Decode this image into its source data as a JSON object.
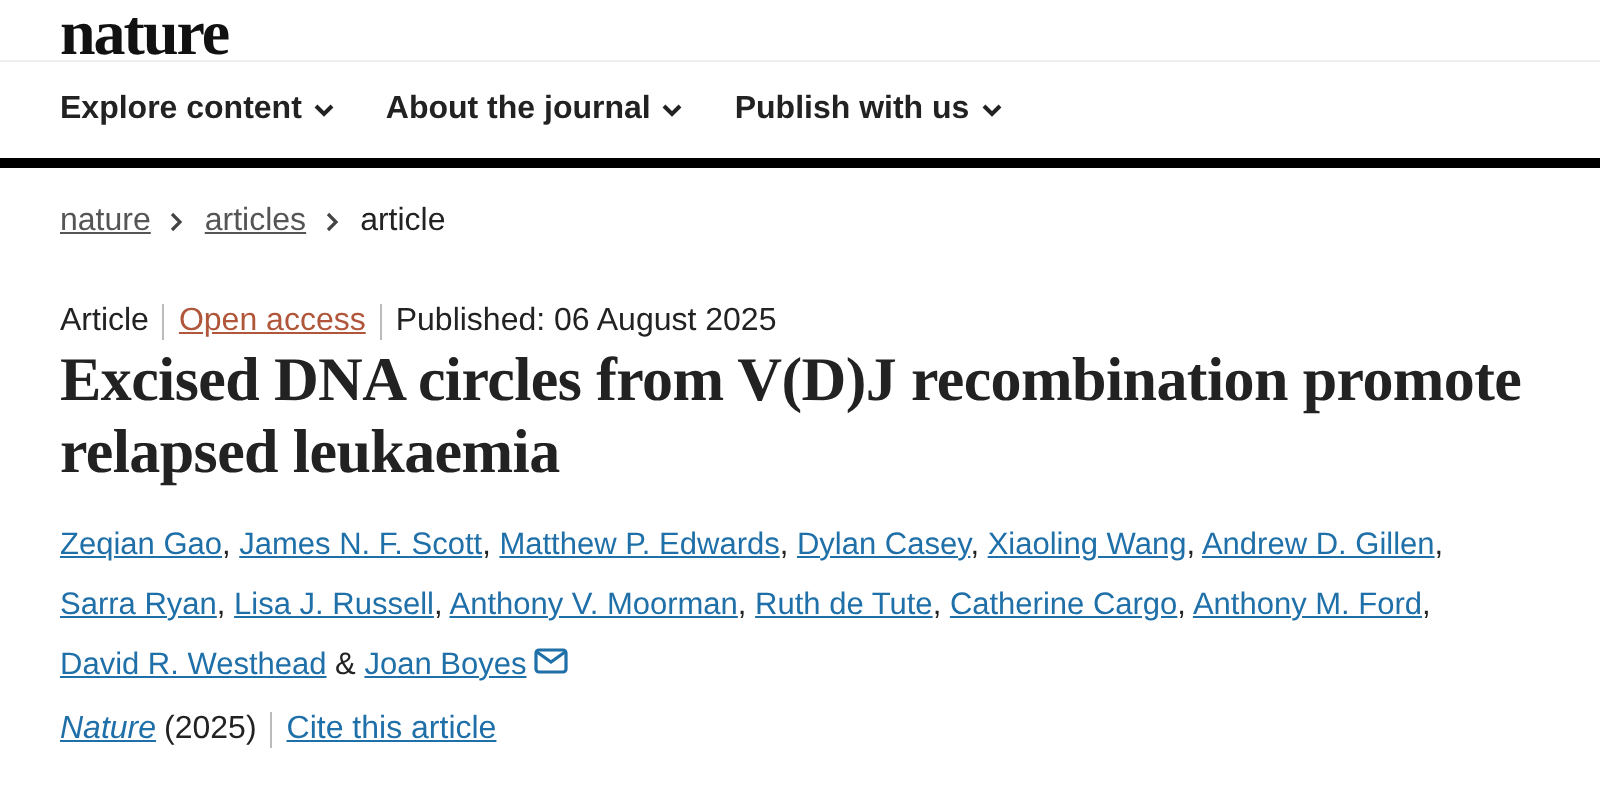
{
  "logo": "nature",
  "nav": [
    {
      "label": "Explore content"
    },
    {
      "label": "About the journal"
    },
    {
      "label": "Publish with us"
    }
  ],
  "breadcrumb": {
    "links": [
      "nature",
      "articles"
    ],
    "current": "article"
  },
  "meta": {
    "type": "Article",
    "access": "Open access",
    "published": "Published: 06 August 2025"
  },
  "title": "Excised DNA circles from V(D)J recombination promote relapsed leukaemia",
  "authors": [
    {
      "name": "Zeqian Gao",
      "separator": ","
    },
    {
      "name": "James N. F. Scott",
      "separator": ","
    },
    {
      "name": "Matthew P. Edwards",
      "separator": ","
    },
    {
      "name": "Dylan Casey",
      "separator": ","
    },
    {
      "name": "Xiaoling Wang",
      "separator": ","
    },
    {
      "name": "Andrew D. Gillen",
      "separator": ","
    },
    {
      "name": "Sarra Ryan",
      "separator": ","
    },
    {
      "name": "Lisa J. Russell",
      "separator": ","
    },
    {
      "name": "Anthony V. Moorman",
      "separator": ","
    },
    {
      "name": "Ruth de Tute",
      "separator": ","
    },
    {
      "name": "Catherine Cargo",
      "separator": ","
    },
    {
      "name": "Anthony M. Ford",
      "separator": ","
    },
    {
      "name": "David R. Westhead",
      "separator": "&"
    }
  ],
  "corresponding_author": "Joan Boyes",
  "citation": {
    "journal": "Nature",
    "year": "(2025)",
    "cite": "Cite this article"
  }
}
